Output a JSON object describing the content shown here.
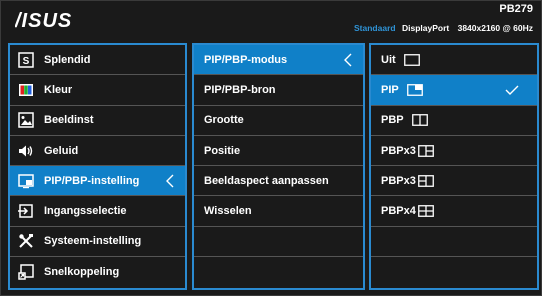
{
  "header": {
    "logo": "ASUS",
    "model": "PB279",
    "preset": "Standaard",
    "input": "DisplayPort",
    "resolution": "3840x2160 @ 60Hz"
  },
  "main_menu": [
    {
      "label": "Splendid",
      "icon": "splendid-icon"
    },
    {
      "label": "Kleur",
      "icon": "color-icon"
    },
    {
      "label": "Beeldinst",
      "icon": "image-icon"
    },
    {
      "label": "Geluid",
      "icon": "speaker-icon"
    },
    {
      "label": "PIP/PBP-instelling",
      "icon": "pip-icon",
      "selected": true
    },
    {
      "label": "Ingangsselectie",
      "icon": "input-icon"
    },
    {
      "label": "Systeem-instelling",
      "icon": "tools-icon"
    },
    {
      "label": "Snelkoppeling",
      "icon": "shortcut-icon"
    }
  ],
  "sub_menu": [
    {
      "label": "PIP/PBP-modus",
      "selected": true
    },
    {
      "label": "PIP/PBP-bron"
    },
    {
      "label": "Grootte"
    },
    {
      "label": "Positie"
    },
    {
      "label": "Beeldaspect aanpassen"
    },
    {
      "label": "Wisselen"
    },
    {
      "label": ""
    },
    {
      "label": ""
    }
  ],
  "options": [
    {
      "label": "Uit",
      "icon": "off-window-icon"
    },
    {
      "label": "PIP",
      "icon": "pip-window-icon",
      "selected": true
    },
    {
      "label": "PBP",
      "icon": "pbp-window-icon"
    },
    {
      "label": "PBPx3",
      "icon": "pbpx3a-window-icon"
    },
    {
      "label": "PBPx3",
      "icon": "pbpx3b-window-icon"
    },
    {
      "label": "PBPx4",
      "icon": "pbpx4-window-icon"
    },
    {
      "label": ""
    },
    {
      "label": ""
    }
  ],
  "colors": {
    "accent": "#1080c8",
    "border": "#2a8ad0",
    "background": "#1a1a1a"
  }
}
